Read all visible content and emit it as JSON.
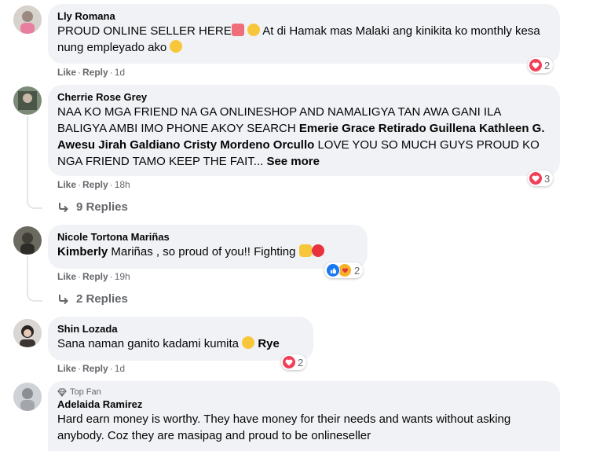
{
  "comments": [
    {
      "name": "Lly Romana",
      "text": "PROUD ONLINE SELLER HERE",
      "text2": " At di Hamak mas Malaki ang kinikita ko monthly kesa nung empleyado ako",
      "like": "Like",
      "reply": "Reply",
      "time": "1d",
      "reactions": "2"
    },
    {
      "name": "Cherrie Rose Grey",
      "text_a": "NAA KO MGA FRIEND NA GA ONLINESHOP AND NAMALIGYA TAN AWA GANI ILA BALIGYA AMBI IMO PHONE AKOY SEARCH ",
      "tagged": "Emerie Grace Retirado Guillena Kathleen G. Awesu Jirah Galdiano Cristy Mordeno Orcullo",
      "text_b": " LOVE YOU SO MUCH GUYS PROUD KO NGA FRIEND TAMO KEEP THE FAIT... ",
      "see_more": "See more",
      "like": "Like",
      "reply": "Reply",
      "time": "18h",
      "reactions": "3",
      "replies": "9 Replies"
    },
    {
      "name": "Nicole Tortona Mariñas",
      "tagged": "Kimberly",
      "text": " Mariñas , so proud of you!! Fighting ",
      "like": "Like",
      "reply": "Reply",
      "time": "19h",
      "reactions": "2",
      "replies": "2 Replies"
    },
    {
      "name": "Shin Lozada",
      "text": "Sana naman ganito kadami kumita ",
      "tagged": "Rye",
      "like": "Like",
      "reply": "Reply",
      "time": "1d",
      "reactions": "2"
    },
    {
      "badge": "Top Fan",
      "name": "Adelaida Ramirez",
      "text": "Hard earn money is worthy. They have money for their needs and wants without asking anybody. Coz they are masipag and proud to be onlineseller"
    }
  ],
  "colors": {
    "bubble": "#f0f2f5",
    "meta": "#65676b",
    "heart": "#f33e58",
    "like": "#1877f2"
  }
}
